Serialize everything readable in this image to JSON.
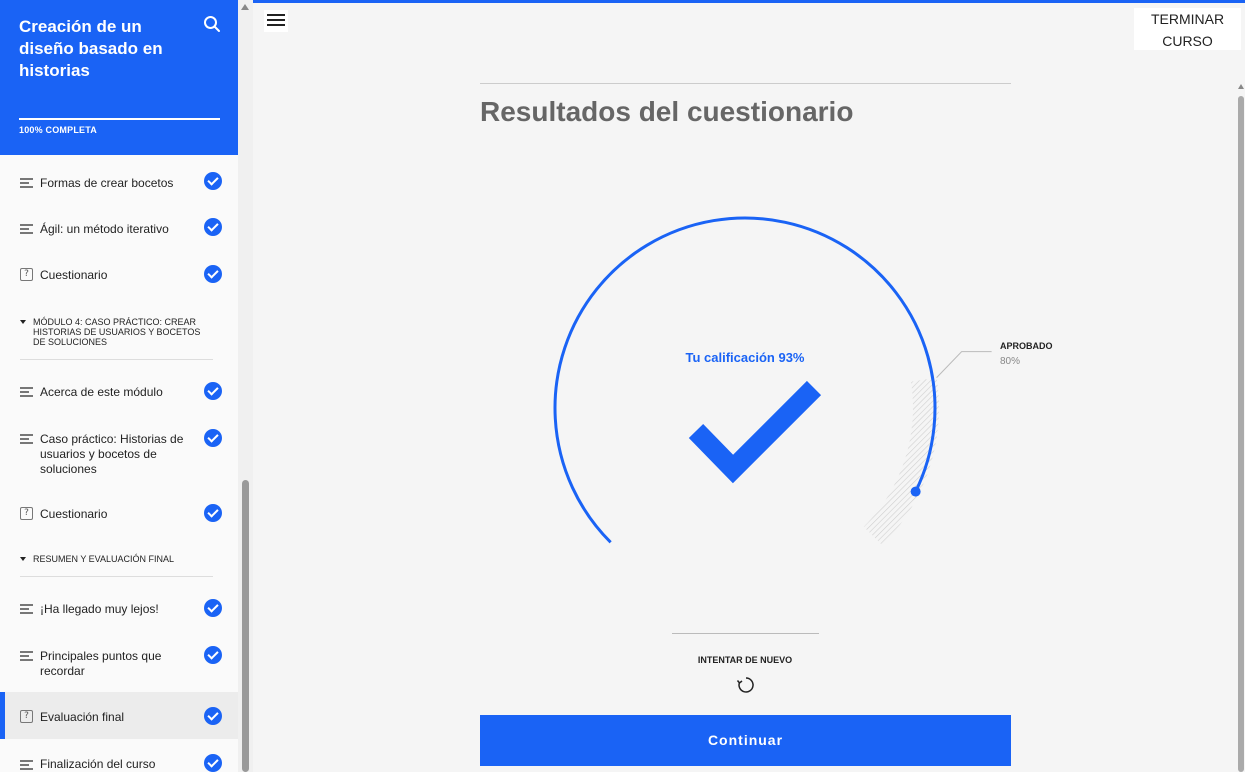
{
  "sidebar": {
    "course_title": "Creación de un diseño basado en historias",
    "progress_label": "100% COMPLETA",
    "progress_fraction": 1.0,
    "items": [
      {
        "label": "Formas de crear bocetos",
        "icon": "lines-icon",
        "completed": true
      },
      {
        "label": "Ágil: un método iterativo",
        "icon": "lines-icon",
        "completed": true
      },
      {
        "label": "Cuestionario",
        "icon": "quiz-icon",
        "completed": true
      },
      {
        "module": "MÓDULO 4: CASO PRÁCTICO: CREAR HISTORIAS DE USUARIOS Y BOCETOS DE SOLUCIONES"
      },
      {
        "label": "Acerca de este módulo",
        "icon": "lines-icon",
        "completed": true
      },
      {
        "label": "Caso práctico: Historias de usuarios y bocetos de soluciones",
        "icon": "lines-icon",
        "completed": true
      },
      {
        "label": "Cuestionario",
        "icon": "quiz-icon",
        "completed": true
      },
      {
        "module": "RESUMEN Y EVALUACIÓN FINAL"
      },
      {
        "label": "¡Ha llegado muy lejos!",
        "icon": "lines-icon",
        "completed": true
      },
      {
        "label": "Principales puntos que recordar",
        "icon": "lines-icon",
        "completed": true
      },
      {
        "label": "Evaluación final",
        "icon": "quiz-icon",
        "completed": true,
        "active": true
      },
      {
        "label": "Finalización del curso",
        "icon": "lines-icon",
        "completed": true
      }
    ]
  },
  "header": {
    "exit_line1": "TERMINAR",
    "exit_line2": "CURSO"
  },
  "results": {
    "title": "Resultados del cuestionario",
    "score_label": "Tu calificación 93%",
    "score_percent": 93,
    "pass_label": "APROBADO",
    "pass_value": "80%",
    "pass_percent": 80,
    "retry_label": "INTENTAR DE NUEVO",
    "continue_label": "Continuar"
  },
  "colors": {
    "accent": "#1a63f5",
    "title_gray": "#666666"
  }
}
